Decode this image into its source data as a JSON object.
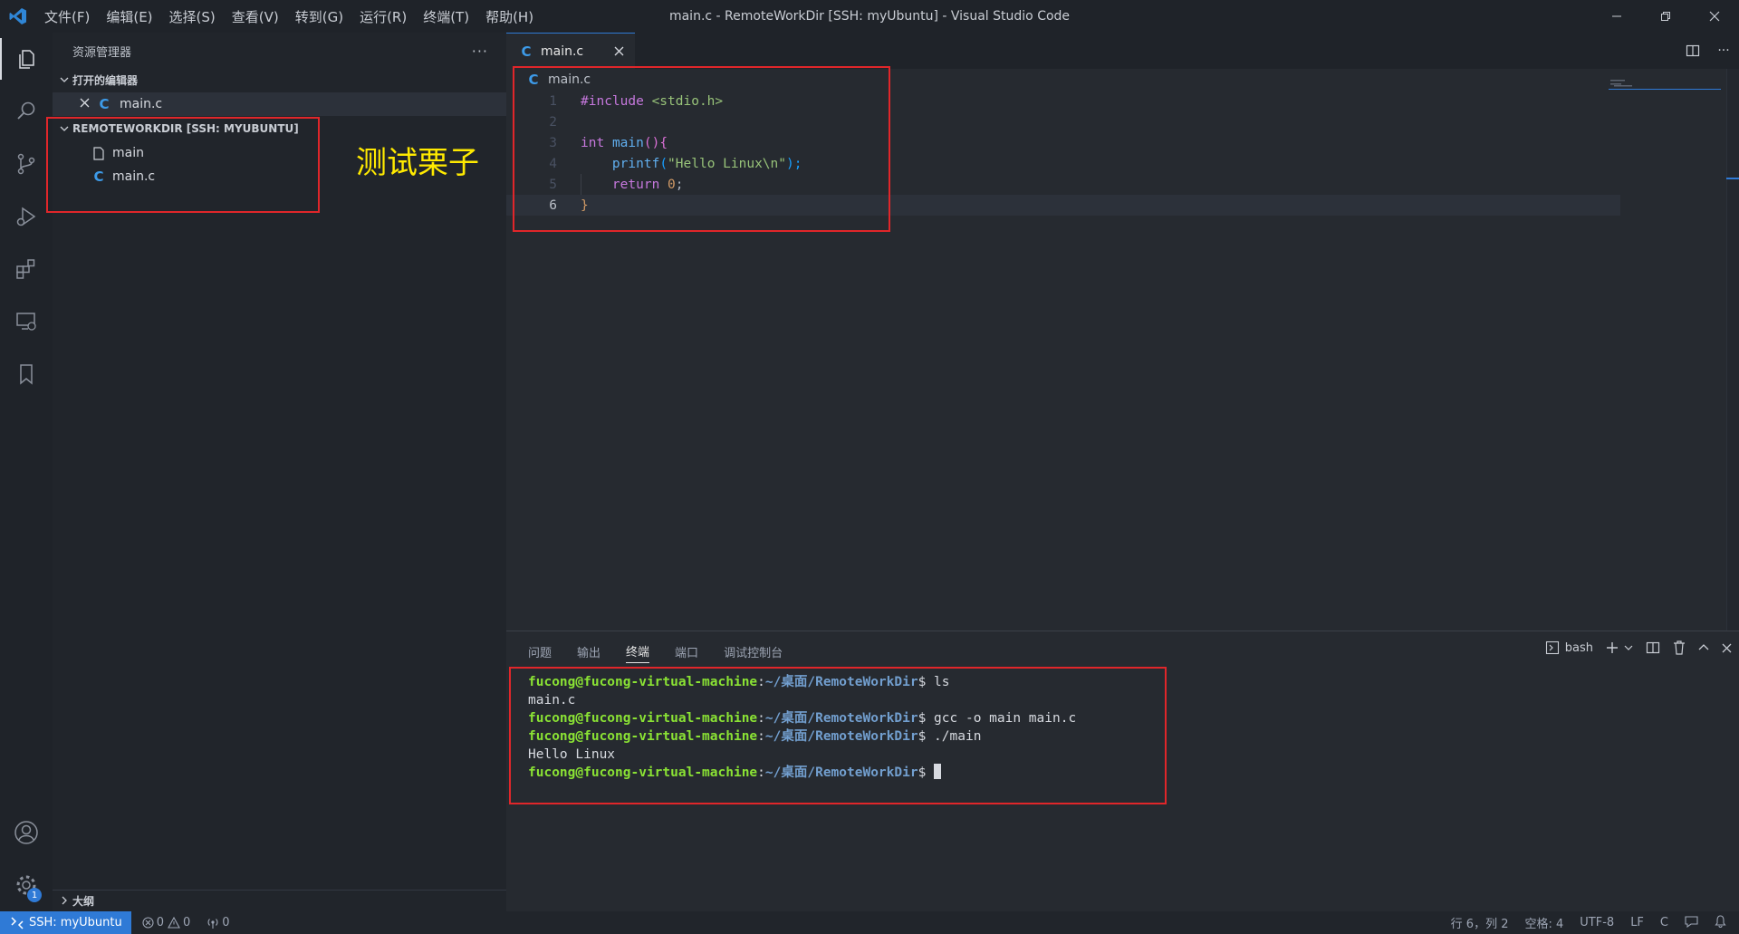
{
  "window": {
    "title": "main.c - RemoteWorkDir [SSH: myUbuntu] - Visual Studio Code",
    "menu": [
      "文件(F)",
      "编辑(E)",
      "选择(S)",
      "查看(V)",
      "转到(G)",
      "运行(R)",
      "终端(T)",
      "帮助(H)"
    ]
  },
  "activity_bar": {
    "items": [
      "explorer-icon",
      "search-icon",
      "source-control-icon",
      "run-debug-icon",
      "extensions-icon",
      "remote-explorer-icon",
      "bookmark-icon"
    ],
    "bottom": [
      "account-icon",
      "settings-gear-icon"
    ],
    "settings_badge": "1"
  },
  "sidebar": {
    "title": "资源管理器",
    "more": "···",
    "open_editors": {
      "label": "打开的编辑器",
      "files": [
        {
          "name": "main.c"
        }
      ]
    },
    "folder": {
      "label": "REMOTEWORKDIR [SSH: MYUBUNTU]",
      "files": [
        {
          "name": "main"
        },
        {
          "name": "main.c"
        }
      ]
    },
    "outline_label": "大纲"
  },
  "annotation": "测试栗子",
  "editor": {
    "tab": "main.c",
    "breadcrumb": "main.c",
    "line_numbers": [
      "1",
      "2",
      "3",
      "4",
      "5",
      "6"
    ],
    "code": {
      "l1_kw": "#include",
      "l1_str": "<stdio.h>",
      "l3_type": "int",
      "l3_fn": "main",
      "l3_rest1": "(",
      "l3_rest2": ")",
      "l3_brace": "{",
      "l4_fn": "printf",
      "l4_open": "(",
      "l4_str": "\"Hello Linux\\n\"",
      "l4_close": ");",
      "l5_kw": "return",
      "l5_num": "0",
      "l5_semi": ";",
      "l6_brace": "}"
    }
  },
  "panel": {
    "tabs": [
      "问题",
      "输出",
      "终端",
      "端口",
      "调试控制台"
    ],
    "active_tab": "终端",
    "shell": "bash",
    "terminal": [
      {
        "user": "fucong@fucong-virtual-machine",
        "path": "~/桌面/RemoteWorkDir",
        "cmd": "$ ls"
      },
      {
        "output": "main.c"
      },
      {
        "user": "fucong@fucong-virtual-machine",
        "path": "~/桌面/RemoteWorkDir",
        "cmd": "$ gcc -o main main.c"
      },
      {
        "user": "fucong@fucong-virtual-machine",
        "path": "~/桌面/RemoteWorkDir",
        "cmd": "$ ./main"
      },
      {
        "output": "Hello Linux"
      },
      {
        "user": "fucong@fucong-virtual-machine",
        "path": "~/桌面/RemoteWorkDir",
        "cmd": "$ "
      }
    ]
  },
  "status": {
    "remote": "SSH: myUbuntu",
    "errors": "0",
    "warnings": "0",
    "ports": "0",
    "position": "行 6，列 2",
    "spaces": "空格: 4",
    "encoding": "UTF-8",
    "eol": "LF",
    "language": "C"
  },
  "colors": {
    "accent": "#2f7ad6",
    "annotation_box": "#e0262a",
    "annotation_text": "#ffea00"
  }
}
